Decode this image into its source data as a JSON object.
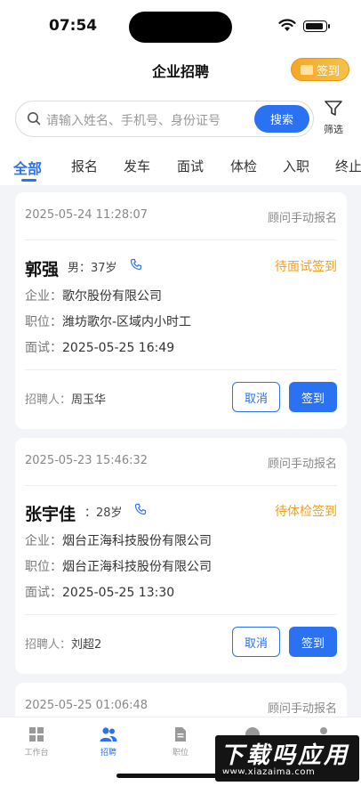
{
  "status_bar": {
    "time": "07:54"
  },
  "header": {
    "title": "企业招聘",
    "checkin_label": "签到"
  },
  "search": {
    "placeholder": "请输入姓名、手机号、身份证号",
    "button_label": "搜索",
    "filter_label": "筛选"
  },
  "tabs": [
    "全部",
    "报名",
    "发车",
    "面试",
    "体检",
    "入职",
    "终止"
  ],
  "active_tab": "全部",
  "cards": [
    {
      "date": "2025-05-24 11:28:07",
      "source": "顾问手动报名",
      "name": "郭强",
      "meta": "男：37岁",
      "status": "待面试签到",
      "company_label": "企业：",
      "company": "歌尔股份有限公司",
      "position_label": "职位：",
      "position": "潍坊歌尔-区域内小时工",
      "interview_label": "面试：",
      "interview": "2025-05-25 16:49",
      "recruiter_label": "招聘人：",
      "recruiter": "周玉华",
      "cancel_label": "取消",
      "sign_label": "签到"
    },
    {
      "date": "2025-05-23 15:46:32",
      "source": "顾问手动报名",
      "name": "张宇佳",
      "meta": "：28岁",
      "status": "待体检签到",
      "company_label": "企业：",
      "company": "烟台正海科技股份有限公司",
      "position_label": "职位：",
      "position": "烟台正海科技股份有限公司",
      "interview_label": "面试：",
      "interview": "2025-05-25 13:30",
      "recruiter_label": "招聘人：",
      "recruiter": "刘超2",
      "cancel_label": "取消",
      "sign_label": "签到"
    },
    {
      "date": "2025-05-25 01:06:48",
      "source": "顾问手动报名"
    }
  ],
  "bottom_nav": [
    {
      "label": "工作台",
      "icon": "grid-icon",
      "active": false
    },
    {
      "label": "招聘",
      "icon": "users-icon",
      "active": true
    },
    {
      "label": "职位",
      "icon": "document-icon",
      "active": false
    },
    {
      "label": "",
      "icon": "message-icon",
      "active": false
    },
    {
      "label": "",
      "icon": "person-icon",
      "active": false
    }
  ],
  "watermark": {
    "title": "下载吗应用",
    "url": "www.xiazaima.com"
  },
  "colors": {
    "accent": "#2a72f2",
    "warning": "#f0a021",
    "background": "#f3f4f7"
  }
}
